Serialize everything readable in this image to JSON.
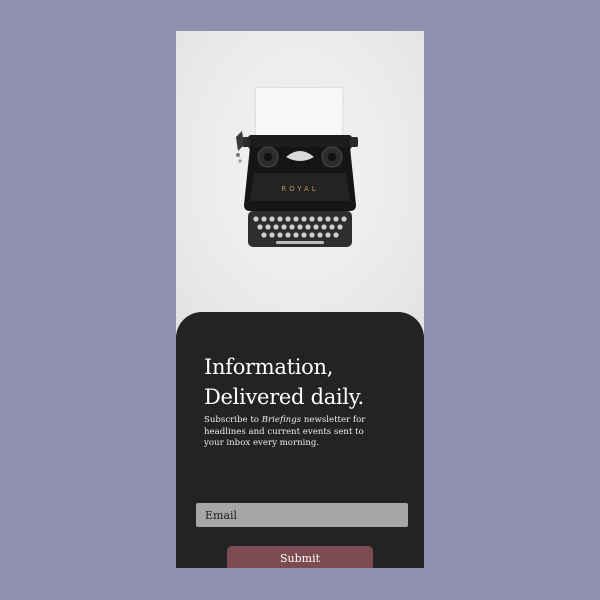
{
  "hero": {
    "image_name": "typewriter-photo",
    "typewriter_brand": "ROYAL"
  },
  "panel": {
    "headline_line1": "Information,",
    "headline_line2": "Delivered daily.",
    "description_prefix": "Subscribe to ",
    "description_brand": "Briefings",
    "description_suffix": " newsletter for headlines and current events sent to your inbox every morning."
  },
  "form": {
    "email_placeholder": "Email",
    "email_value": "",
    "submit_label": "Submit"
  },
  "colors": {
    "page_background": "#8e90ad",
    "panel_background": "#232323",
    "input_background": "#a6a6a6",
    "button_background": "#7d4c52"
  }
}
